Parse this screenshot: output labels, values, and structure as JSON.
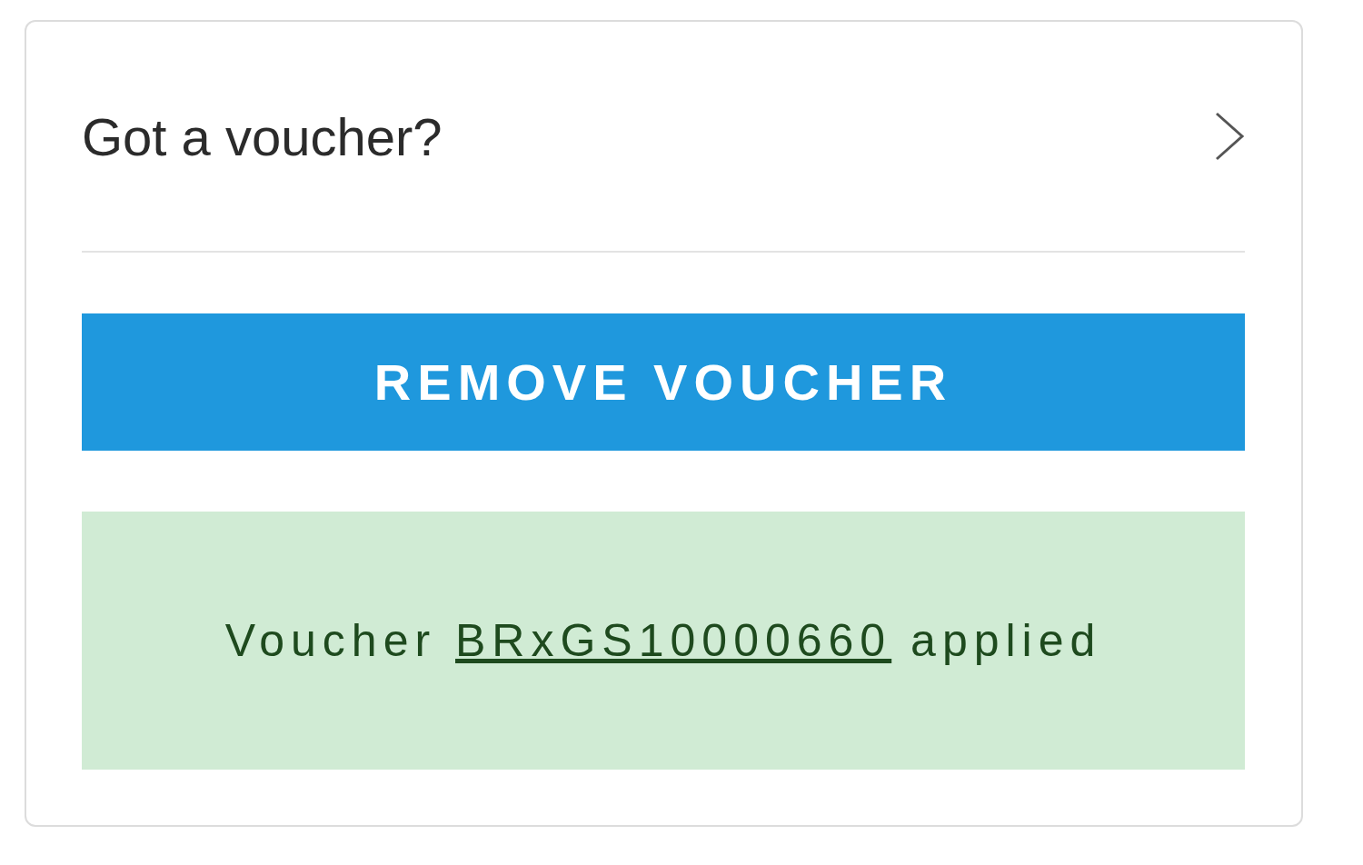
{
  "voucher_card": {
    "title": "Got a voucher?"
  },
  "remove_button": {
    "label": "REMOVE VOUCHER"
  },
  "message": {
    "prefix": "Voucher",
    "code": "BRxGS10000660",
    "suffix": "applied"
  }
}
